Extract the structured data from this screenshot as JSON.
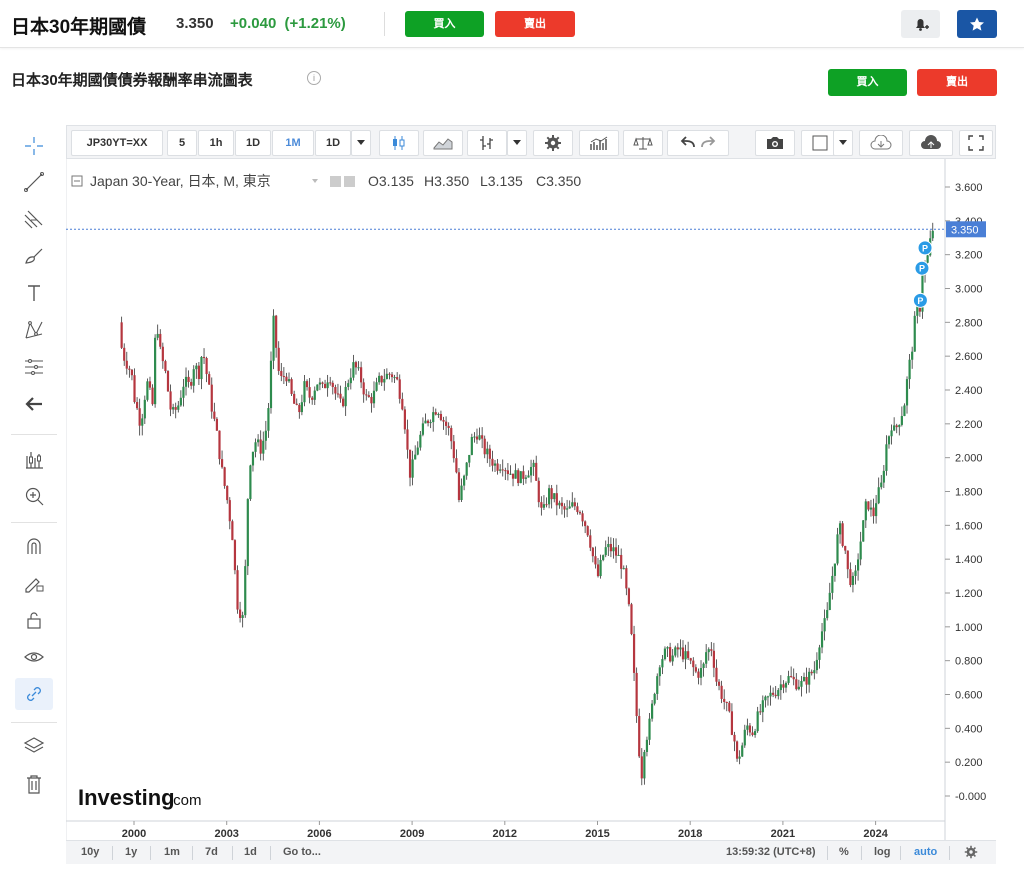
{
  "header": {
    "name": "日本30年期國債",
    "price": "3.350",
    "change": "+0.040",
    "change_pct": "(+1.21%)",
    "buy_label": "買入",
    "sell_label": "賣出",
    "change_color": "#2c9a3f"
  },
  "section": {
    "title": "日本30年期國債債券報酬率串流圖表",
    "info": "i",
    "buy_label": "買入",
    "sell_label": "賣出"
  },
  "left_toolbar": {
    "icons": [
      "crosshair-icon",
      "trend-line-icon",
      "fib-icon",
      "brush-icon",
      "text-icon",
      "pattern-icon",
      "prediction-icon",
      "back-arrow-icon",
      "measure-icon",
      "zoom-in-icon",
      "magnet-icon",
      "lock-drawing-icon",
      "unlock-icon",
      "eye-icon",
      "link-icon",
      "layers-icon",
      "trash-icon"
    ]
  },
  "toolbar": {
    "symbol": "JP30YT=XX",
    "intervals": [
      "5",
      "1h",
      "1D",
      "1M",
      "1D"
    ],
    "active_interval": "1M"
  },
  "legend": {
    "name": "Japan 30-Year, 日本, M, 東京",
    "open": "O3.135",
    "high": "H3.350",
    "low": "L3.135",
    "close": "C3.350"
  },
  "watermark": {
    "brand": "Investing",
    "suffix": ".com"
  },
  "bottom_bar": {
    "ranges": [
      "10y",
      "1y",
      "1m",
      "7d",
      "1d",
      "Go to..."
    ],
    "time": "13:59:32 (UTC+8)",
    "percent": "%",
    "log": "log",
    "auto": "auto"
  },
  "colors": {
    "up": "#2e8b4e",
    "down": "#b5363f",
    "last_price_bg": "#4a7fd6",
    "marker": "#2a9be6",
    "buy": "#0ea125",
    "sell": "#ec3a2b"
  },
  "chart_data": {
    "type": "candlestick",
    "title": "Japan 30-Year, 日本, M, 東京",
    "x_tick_labels": [
      "2000",
      "2003",
      "2006",
      "2009",
      "2012",
      "2015",
      "2018",
      "2021",
      "2024"
    ],
    "y_tick_labels": [
      "3.600",
      "3.400",
      "3.200",
      "3.000",
      "2.800",
      "2.600",
      "2.400",
      "2.200",
      "2.000",
      "1.800",
      "1.600",
      "1.400",
      "1.200",
      "1.000",
      "0.800",
      "0.600",
      "0.400",
      "0.200",
      "-0.000"
    ],
    "ylim": [
      -0.1,
      3.65
    ],
    "xlim": [
      1999.2,
      2026.3
    ],
    "last_value": "3.350",
    "marker_label": "P",
    "markers": [
      [
        2025.6,
        3.24
      ],
      [
        2025.5,
        3.12
      ],
      [
        2025.45,
        2.93
      ]
    ],
    "points": [
      [
        1999.6,
        2.8
      ],
      [
        1999.7,
        2.62
      ],
      [
        2000.0,
        2.5
      ],
      [
        2000.1,
        2.35
      ],
      [
        2000.3,
        2.2
      ],
      [
        2000.5,
        2.45
      ],
      [
        2000.7,
        2.3
      ],
      [
        2000.8,
        2.88
      ],
      [
        2000.9,
        2.65
      ],
      [
        2001.1,
        2.5
      ],
      [
        2001.3,
        2.25
      ],
      [
        2001.5,
        2.3
      ],
      [
        2001.7,
        2.45
      ],
      [
        2001.9,
        2.42
      ],
      [
        2002.0,
        2.55
      ],
      [
        2002.2,
        2.5
      ],
      [
        2002.3,
        2.65
      ],
      [
        2002.5,
        2.42
      ],
      [
        2002.6,
        2.3
      ],
      [
        2002.8,
        2.1
      ],
      [
        2002.9,
        1.95
      ],
      [
        2003.1,
        1.75
      ],
      [
        2003.3,
        1.5
      ],
      [
        2003.4,
        1.15
      ],
      [
        2003.6,
        1.05
      ],
      [
        2003.7,
        1.4
      ],
      [
        2003.8,
        1.95
      ],
      [
        2004.0,
        2.1
      ],
      [
        2004.2,
        2.05
      ],
      [
        2004.4,
        2.2
      ],
      [
        2004.5,
        2.5
      ],
      [
        2004.6,
        2.8
      ],
      [
        2004.8,
        2.45
      ],
      [
        2005.0,
        2.5
      ],
      [
        2005.2,
        2.35
      ],
      [
        2005.4,
        2.25
      ],
      [
        2005.6,
        2.42
      ],
      [
        2005.8,
        2.35
      ],
      [
        2006.0,
        2.45
      ],
      [
        2006.2,
        2.4
      ],
      [
        2006.4,
        2.5
      ],
      [
        2006.6,
        2.38
      ],
      [
        2006.8,
        2.3
      ],
      [
        2007.0,
        2.45
      ],
      [
        2007.2,
        2.55
      ],
      [
        2007.4,
        2.48
      ],
      [
        2007.6,
        2.35
      ],
      [
        2007.8,
        2.35
      ],
      [
        2008.0,
        2.45
      ],
      [
        2008.2,
        2.48
      ],
      [
        2008.4,
        2.5
      ],
      [
        2008.6,
        2.45
      ],
      [
        2008.8,
        2.3
      ],
      [
        2009.0,
        1.9
      ],
      [
        2009.1,
        1.95
      ],
      [
        2009.3,
        2.1
      ],
      [
        2009.5,
        2.2
      ],
      [
        2009.7,
        2.25
      ],
      [
        2009.9,
        2.3
      ],
      [
        2010.1,
        2.22
      ],
      [
        2010.3,
        2.15
      ],
      [
        2010.5,
        1.95
      ],
      [
        2010.6,
        1.75
      ],
      [
        2010.8,
        1.9
      ],
      [
        2011.0,
        2.1
      ],
      [
        2011.2,
        2.15
      ],
      [
        2011.4,
        2.05
      ],
      [
        2011.6,
        2.0
      ],
      [
        2011.8,
        1.95
      ],
      [
        2012.0,
        1.97
      ],
      [
        2012.2,
        1.92
      ],
      [
        2012.4,
        1.9
      ],
      [
        2012.6,
        1.88
      ],
      [
        2012.8,
        1.92
      ],
      [
        2013.0,
        1.95
      ],
      [
        2013.1,
        1.85
      ],
      [
        2013.3,
        1.65
      ],
      [
        2013.5,
        1.8
      ],
      [
        2013.7,
        1.75
      ],
      [
        2013.9,
        1.7
      ],
      [
        2014.1,
        1.68
      ],
      [
        2014.3,
        1.72
      ],
      [
        2014.5,
        1.7
      ],
      [
        2014.7,
        1.6
      ],
      [
        2014.8,
        1.55
      ],
      [
        2015.0,
        1.35
      ],
      [
        2015.1,
        1.3
      ],
      [
        2015.3,
        1.45
      ],
      [
        2015.4,
        1.47
      ],
      [
        2015.6,
        1.45
      ],
      [
        2015.8,
        1.4
      ],
      [
        2015.9,
        1.35
      ],
      [
        2016.1,
        1.1
      ],
      [
        2016.2,
        0.9
      ],
      [
        2016.3,
        0.6
      ],
      [
        2016.4,
        0.35
      ],
      [
        2016.5,
        0.1
      ],
      [
        2016.6,
        0.3
      ],
      [
        2016.8,
        0.45
      ],
      [
        2016.9,
        0.6
      ],
      [
        2017.1,
        0.8
      ],
      [
        2017.3,
        0.85
      ],
      [
        2017.5,
        0.82
      ],
      [
        2017.7,
        0.87
      ],
      [
        2017.9,
        0.83
      ],
      [
        2018.1,
        0.78
      ],
      [
        2018.3,
        0.72
      ],
      [
        2018.5,
        0.75
      ],
      [
        2018.6,
        0.85
      ],
      [
        2018.8,
        0.88
      ],
      [
        2018.9,
        0.7
      ],
      [
        2019.1,
        0.6
      ],
      [
        2019.3,
        0.5
      ],
      [
        2019.5,
        0.35
      ],
      [
        2019.6,
        0.2
      ],
      [
        2019.8,
        0.32
      ],
      [
        2019.9,
        0.42
      ],
      [
        2020.1,
        0.38
      ],
      [
        2020.3,
        0.48
      ],
      [
        2020.5,
        0.55
      ],
      [
        2020.7,
        0.6
      ],
      [
        2020.9,
        0.63
      ],
      [
        2021.1,
        0.68
      ],
      [
        2021.3,
        0.7
      ],
      [
        2021.5,
        0.67
      ],
      [
        2021.7,
        0.66
      ],
      [
        2021.9,
        0.7
      ],
      [
        2022.1,
        0.75
      ],
      [
        2022.3,
        0.95
      ],
      [
        2022.5,
        1.05
      ],
      [
        2022.6,
        1.2
      ],
      [
        2022.8,
        1.45
      ],
      [
        2022.9,
        1.6
      ],
      [
        2023.1,
        1.45
      ],
      [
        2023.2,
        1.3
      ],
      [
        2023.4,
        1.25
      ],
      [
        2023.5,
        1.4
      ],
      [
        2023.7,
        1.62
      ],
      [
        2023.8,
        1.75
      ],
      [
        2024.0,
        1.65
      ],
      [
        2024.1,
        1.75
      ],
      [
        2024.3,
        1.85
      ],
      [
        2024.4,
        2.05
      ],
      [
        2024.6,
        2.2
      ],
      [
        2024.7,
        2.15
      ],
      [
        2024.9,
        2.25
      ],
      [
        2025.0,
        2.3
      ],
      [
        2025.1,
        2.45
      ],
      [
        2025.3,
        2.7
      ],
      [
        2025.4,
        2.9
      ],
      [
        2025.5,
        2.85
      ],
      [
        2025.6,
        3.1
      ],
      [
        2025.7,
        3.15
      ],
      [
        2025.8,
        3.2
      ],
      [
        2025.9,
        3.35
      ]
    ]
  }
}
